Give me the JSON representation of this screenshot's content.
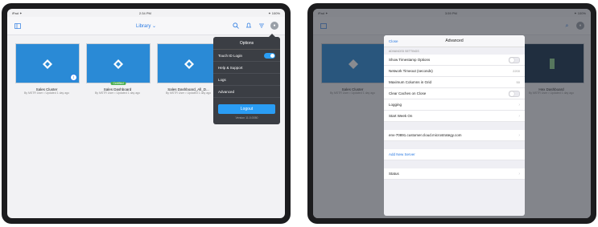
{
  "left": {
    "status": {
      "carrier": "iPad ✦",
      "time": "2:34 PM",
      "battery": "✦ 100%"
    },
    "nav": {
      "title": "Library ⌄",
      "menu_icon": "sidebar-icon"
    },
    "cards": [
      {
        "title": "Sales Cluster",
        "sub": "By MSTR User • Updated 1 day ago",
        "badge": ""
      },
      {
        "title": "Sales Dashboard",
        "sub": "By MSTR User • Updated 1 day ago",
        "badge": "Certified"
      },
      {
        "title": "Sales Dashboard_All_D...",
        "sub": "By MSTR User • Updated 1 day ago",
        "badge": ""
      }
    ],
    "popover": {
      "title": "Options",
      "items": [
        "Touch ID Login",
        "Help & Support",
        "Logs",
        "Advanced"
      ],
      "logout": "Logout",
      "version": "Version 11.0.0050"
    }
  },
  "right": {
    "status": {
      "carrier": "iPad ✦",
      "time": "3:59 PM",
      "battery": "✦ 100%"
    },
    "sheet": {
      "close": "Close",
      "title": "Advanced",
      "section": "ADVANCED SETTINGS",
      "rows": [
        {
          "label": "Show Timestamp Options",
          "value": ""
        },
        {
          "label": "Network Timeout (seconds)",
          "value": "2200"
        },
        {
          "label": "Maximum Columns in Grid",
          "value": "50"
        },
        {
          "label": "Clear Caches on Close",
          "value": ""
        },
        {
          "label": "Logging",
          "value": ""
        },
        {
          "label": "Start Week On",
          "value": ""
        }
      ],
      "server": "env-70891.customer.cloud.microstrategy.com",
      "add_server": "Add New Server",
      "status": "Status"
    },
    "bg_cards": [
      {
        "title": "Sales Cluster",
        "sub": "By MSTR User • Updated 1 day ago"
      },
      {
        "title": "Hex Dashboard",
        "sub": "By MSTR User • Updated 1 day ago"
      }
    ]
  }
}
